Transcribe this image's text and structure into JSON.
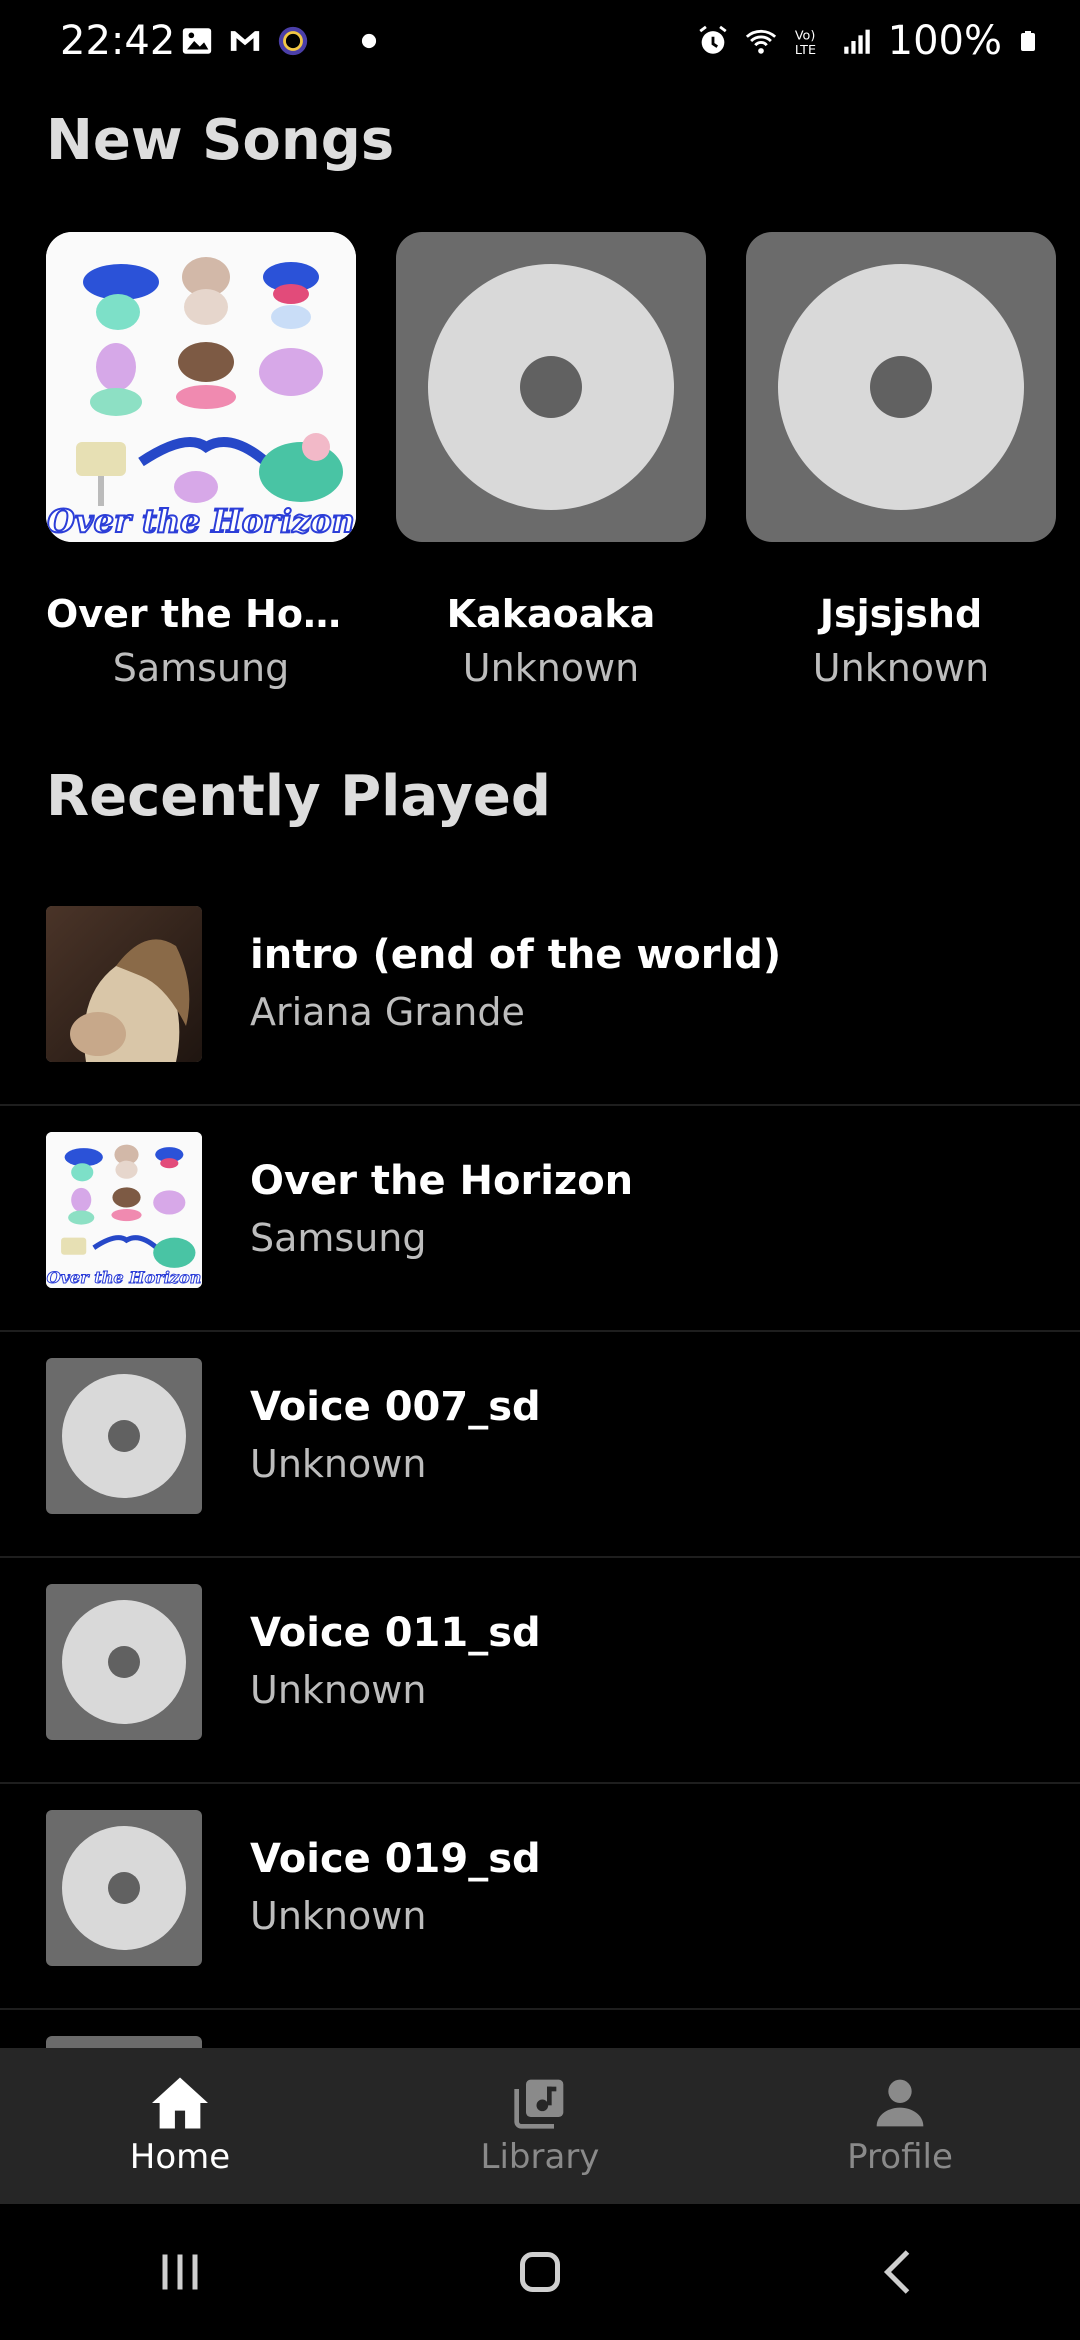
{
  "status_bar": {
    "time": "22:42",
    "battery": "100%",
    "left_icons": [
      "image-icon",
      "gmail-icon",
      "circle-app-icon",
      "dot-icon"
    ],
    "right_icons": [
      "alarm-icon",
      "wifi-icon",
      "volte-icon",
      "signal-icon",
      "battery-icon"
    ]
  },
  "new_songs": {
    "title": "New Songs",
    "items": [
      {
        "title": "Over the Hori…",
        "artist": "Samsung"
      },
      {
        "title": "Kakaoaka",
        "artist": "Unknown"
      },
      {
        "title": "Jsjsjshd",
        "artist": "Unknown"
      }
    ]
  },
  "recently_played": {
    "title": "Recently Played",
    "items": [
      {
        "title": "intro (end of the world)",
        "artist": "Ariana Grande"
      },
      {
        "title": "Over the Horizon",
        "artist": "Samsung"
      },
      {
        "title": "Voice 007_sd",
        "artist": "Unknown"
      },
      {
        "title": "Voice 011_sd",
        "artist": "Unknown"
      },
      {
        "title": "Voice 019_sd",
        "artist": "Unknown"
      }
    ]
  },
  "bottom_nav": {
    "items": [
      {
        "label": "Home",
        "icon": "home-icon",
        "active": true
      },
      {
        "label": "Library",
        "icon": "library-icon",
        "active": false
      },
      {
        "label": "Profile",
        "icon": "profile-icon",
        "active": false
      }
    ]
  },
  "colors": {
    "background": "#000000",
    "nav_background": "#262626",
    "placeholder_bg": "#6b6b6b",
    "disc": "#d9d9d9",
    "secondary_text": "#bdbdbd"
  }
}
